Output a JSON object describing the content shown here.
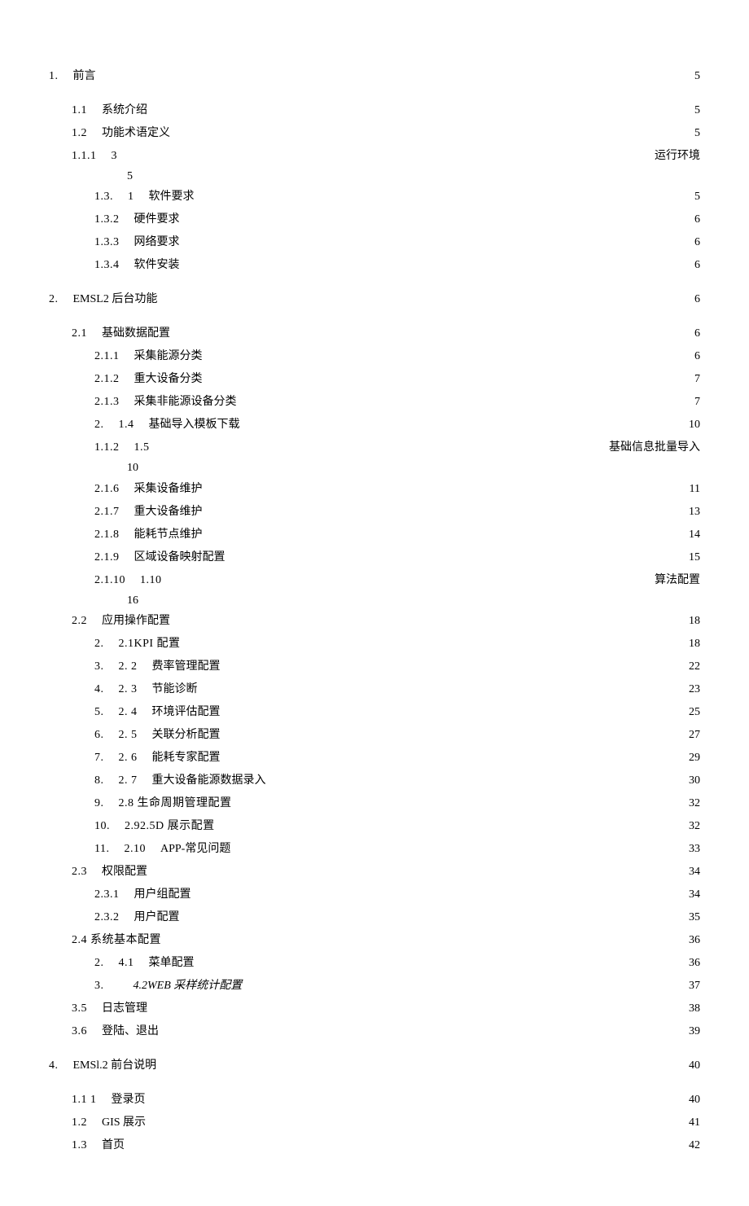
{
  "toc": [
    {
      "type": "line",
      "level": 0,
      "num": "1.",
      "title": "前言",
      "page": "5"
    },
    {
      "type": "gap"
    },
    {
      "type": "line",
      "level": 1,
      "num": "1.1",
      "title": "系统介绍",
      "page": "5"
    },
    {
      "type": "line",
      "level": 1,
      "num": "1.2",
      "title": "功能术语定义",
      "page": "5"
    },
    {
      "type": "line",
      "level": 1,
      "num": "1.1.1",
      "numSuffix": "3",
      "title": "",
      "page": "运行环境",
      "thin": true
    },
    {
      "type": "wrap",
      "text": "5"
    },
    {
      "type": "line",
      "level": 2,
      "num": "1.3.",
      "numSuffix": "1",
      "title": "软件要求",
      "page": "5"
    },
    {
      "type": "line",
      "level": 2,
      "num": "1.3.2",
      "title": "硬件要求",
      "page": "6"
    },
    {
      "type": "line",
      "level": 2,
      "num": "1.3.3",
      "title": "网络要求",
      "page": "6"
    },
    {
      "type": "line",
      "level": 2,
      "num": "1.3.4",
      "title": "软件安装",
      "page": "6"
    },
    {
      "type": "gap"
    },
    {
      "type": "line",
      "level": 0,
      "num": "2.",
      "title": "EMSL2 后台功能",
      "page": "6"
    },
    {
      "type": "gap"
    },
    {
      "type": "line",
      "level": 1,
      "num": "2.1",
      "title": "基础数据配置",
      "page": "6"
    },
    {
      "type": "line",
      "level": 2,
      "num": "2.1.1",
      "title": "采集能源分类",
      "page": "6"
    },
    {
      "type": "line",
      "level": 2,
      "num": "2.1.2",
      "title": "重大设备分类",
      "page": "7"
    },
    {
      "type": "line",
      "level": 2,
      "num": "2.1.3",
      "title": "采集非能源设备分类",
      "page": "7"
    },
    {
      "type": "line",
      "level": 2,
      "num": "2.",
      "numSuffix": "1.4",
      "title": "基础导入模板下载",
      "page": "10"
    },
    {
      "type": "line",
      "level": 2,
      "num": "1.1.2",
      "numSuffix": "1.5",
      "title": "",
      "page": "基础信息批量导入",
      "thin": true
    },
    {
      "type": "wrap",
      "text": "10"
    },
    {
      "type": "line",
      "level": 2,
      "num": "2.1.6",
      "title": "采集设备维护",
      "page": "11"
    },
    {
      "type": "line",
      "level": 2,
      "num": "2.1.7",
      "title": "重大设备维护",
      "page": "13"
    },
    {
      "type": "line",
      "level": 2,
      "num": "2.1.8",
      "title": "能耗节点维护",
      "page": "14"
    },
    {
      "type": "line",
      "level": 2,
      "num": "2.1.9",
      "title": "区域设备映射配置",
      "page": "15"
    },
    {
      "type": "line",
      "level": 2,
      "num": "2.1.10",
      "numSuffix": "1.10",
      "title": "",
      "page": "算法配置",
      "thin": true
    },
    {
      "type": "wrap",
      "text": "16"
    },
    {
      "type": "line",
      "level": 1,
      "num": "2.2",
      "title": "应用操作配置",
      "page": "18"
    },
    {
      "type": "line",
      "level": 2,
      "num": "2.",
      "numSuffix": "2.1KPI 配置",
      "title": "",
      "page": "18"
    },
    {
      "type": "line",
      "level": 2,
      "num": "3.",
      "numSuffix": "2. 2",
      "title": "费率管理配置",
      "page": "22"
    },
    {
      "type": "line",
      "level": 2,
      "num": "4.",
      "numSuffix": "2. 3",
      "title": "节能诊断",
      "page": "23"
    },
    {
      "type": "line",
      "level": 2,
      "num": "5.",
      "numSuffix": "2. 4",
      "title": "环境评估配置",
      "page": "25"
    },
    {
      "type": "line",
      "level": 2,
      "num": "6.",
      "numSuffix": "2. 5",
      "title": "关联分析配置",
      "page": "27"
    },
    {
      "type": "line",
      "level": 2,
      "num": "7.",
      "numSuffix": "2. 6",
      "title": "能耗专家配置",
      "page": "29"
    },
    {
      "type": "line",
      "level": 2,
      "num": "8.",
      "numSuffix": "2. 7",
      "title": "重大设备能源数据录入",
      "page": "30"
    },
    {
      "type": "line",
      "level": 2,
      "num": "9.",
      "numSuffix": "2.8 生命周期管理配置",
      "title": "",
      "page": "32"
    },
    {
      "type": "line",
      "level": 2,
      "num": "10.",
      "numSuffix": "2.92.5D 展示配置",
      "title": "",
      "page": "32"
    },
    {
      "type": "line",
      "level": 2,
      "num": "11.",
      "numSuffix": "2.10",
      "title": "APP-常见问题",
      "page": "33"
    },
    {
      "type": "line",
      "level": 1,
      "num": "2.3",
      "title": "权限配置",
      "page": "34"
    },
    {
      "type": "line",
      "level": 2,
      "num": "2.3.1",
      "title": "用户组配置",
      "page": "34"
    },
    {
      "type": "line",
      "level": 2,
      "num": "2.3.2",
      "title": "用户配置",
      "page": "35"
    },
    {
      "type": "line",
      "level": 1,
      "num": "2.4 系统基本配置",
      "title": "",
      "page": "36"
    },
    {
      "type": "line",
      "level": 2,
      "num": "2.",
      "numSuffix": "4.1",
      "title": "菜单配置",
      "page": "36"
    },
    {
      "type": "line",
      "level": 2,
      "num": "3.",
      "numSuffix": "",
      "title": "4.2WEB 采样统计配置",
      "italicTitle": true,
      "page": "37"
    },
    {
      "type": "line",
      "level": 1,
      "num": "3.5",
      "title": "日志管理",
      "page": "38"
    },
    {
      "type": "line",
      "level": 1,
      "num": "3.6",
      "title": "登陆、退出",
      "page": "39"
    },
    {
      "type": "gap"
    },
    {
      "type": "line",
      "level": 0,
      "num": "4.",
      "title": "EMSl.2 前台说明",
      "page": "40"
    },
    {
      "type": "gap"
    },
    {
      "type": "line",
      "level": 1,
      "num": "1.1 1",
      "title": "登录页",
      "page": "40"
    },
    {
      "type": "line",
      "level": 1,
      "num": "1.2",
      "title": "GIS 展示",
      "page": "41"
    },
    {
      "type": "line",
      "level": 1,
      "num": "1.3",
      "title": "首页",
      "page": "42"
    }
  ]
}
